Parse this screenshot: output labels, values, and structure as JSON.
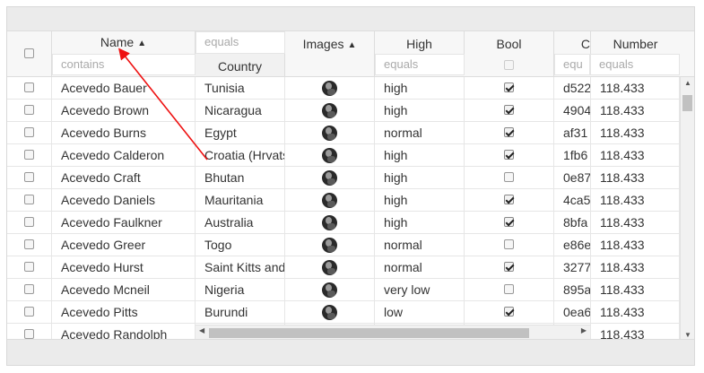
{
  "columns": {
    "name": {
      "label": "Name",
      "filter_placeholder": "contains"
    },
    "country": {
      "label": "Country",
      "filter_placeholder": "equals"
    },
    "images": {
      "label": "Images"
    },
    "high": {
      "label": "High",
      "filter_placeholder": "equals"
    },
    "bool": {
      "label": "Bool"
    },
    "partial": {
      "label": "C",
      "filter_placeholder": "equ"
    },
    "number": {
      "label": "Number",
      "filter_placeholder": "equals"
    }
  },
  "rows": [
    {
      "name": "Acevedo Bauer",
      "country": "Tunisia",
      "high": "high",
      "bool": true,
      "code": "d522",
      "number": "118.433"
    },
    {
      "name": "Acevedo Brown",
      "country": "Nicaragua",
      "high": "high",
      "bool": true,
      "code": "4904",
      "number": "118.433"
    },
    {
      "name": "Acevedo Burns",
      "country": "Egypt",
      "high": "normal",
      "bool": true,
      "code": "af31",
      "number": "118.433"
    },
    {
      "name": "Acevedo Calderon",
      "country": "Croatia (Hrvatska)",
      "high": "high",
      "bool": true,
      "code": "1fb6",
      "number": "118.433"
    },
    {
      "name": "Acevedo Craft",
      "country": "Bhutan",
      "high": "high",
      "bool": false,
      "code": "0e87",
      "number": "118.433"
    },
    {
      "name": "Acevedo Daniels",
      "country": "Mauritania",
      "high": "high",
      "bool": true,
      "code": "4ca5",
      "number": "118.433"
    },
    {
      "name": "Acevedo Faulkner",
      "country": "Australia",
      "high": "high",
      "bool": true,
      "code": "8bfa",
      "number": "118.433"
    },
    {
      "name": "Acevedo Greer",
      "country": "Togo",
      "high": "normal",
      "bool": false,
      "code": "e86e",
      "number": "118.433"
    },
    {
      "name": "Acevedo Hurst",
      "country": "Saint Kitts and Nevis",
      "high": "normal",
      "bool": true,
      "code": "3277",
      "number": "118.433"
    },
    {
      "name": "Acevedo Mcneil",
      "country": "Nigeria",
      "high": "very low",
      "bool": false,
      "code": "895a",
      "number": "118.433"
    },
    {
      "name": "Acevedo Pitts",
      "country": "Burundi",
      "high": "low",
      "bool": true,
      "code": "0ea6",
      "number": "118.433"
    },
    {
      "name": "Acevedo Randolph",
      "country": "",
      "high": "",
      "bool": false,
      "code": "",
      "number": "118.433"
    }
  ],
  "colors": {
    "annotation": "#e11",
    "header_bg": "#f7f7f7",
    "bar_bg": "#ebebeb"
  }
}
